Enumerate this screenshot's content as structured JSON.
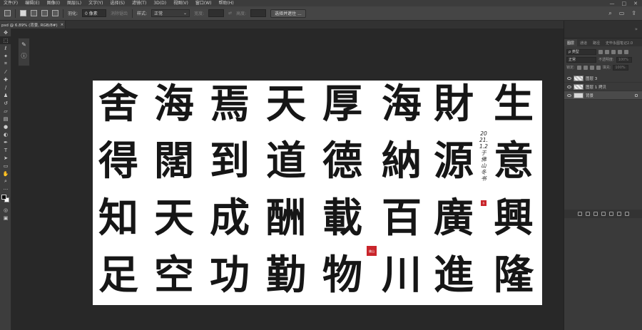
{
  "menubar": {
    "items": [
      "文件(F)",
      "编辑(E)",
      "图像(I)",
      "图层(L)",
      "文字(Y)",
      "选择(S)",
      "滤镜(T)",
      "3D(D)",
      "视图(V)",
      "窗口(W)",
      "帮助(H)"
    ],
    "minimize": "—",
    "maximize": "□",
    "close": "✕"
  },
  "options": {
    "feather_label": "羽化:",
    "feather_value": "0 像素",
    "antialias_label": "消除锯齿",
    "style_label": "样式:",
    "style_value": "正常",
    "width_label": "宽度:",
    "height_label": "高度:",
    "select_mask_button": "选择并遮住 ...",
    "search_icon": "⌕",
    "workspace_icon": "▭",
    "share_icon": "⇪"
  },
  "document_tab": {
    "title": "psd @ 6.89% (背景, RGB/8#)",
    "close": "×"
  },
  "canvas": {
    "characters": [
      "舍",
      "海",
      "焉",
      "天",
      "厚",
      "海",
      "財",
      "生",
      "得",
      "闊",
      "到",
      "道",
      "德",
      "納",
      "源",
      "意",
      "知",
      "天",
      "成",
      "酬",
      "載",
      "百",
      "廣",
      "興",
      "足",
      "空",
      "功",
      "勤",
      "物",
      "川",
      "進",
      "隆"
    ],
    "inscription": "2021.1.2于佛山冬书",
    "seal_left": "佛山",
    "seal_right": "冬"
  },
  "panels": {
    "tabs": [
      "图层",
      "通道",
      "路径",
      "史毕永图笔记2.0"
    ],
    "kind_filter": "ρ 类型",
    "blend_mode": "正常",
    "opacity_label": "不透明度:",
    "opacity_value": "100%",
    "lock_label": "锁定:",
    "fill_label": "填充:",
    "fill_value": "100%",
    "layers": [
      {
        "name": "图层 3",
        "selected": false
      },
      {
        "name": "图层 1 拷贝",
        "selected": false
      },
      {
        "name": "背景",
        "selected": true
      }
    ]
  }
}
